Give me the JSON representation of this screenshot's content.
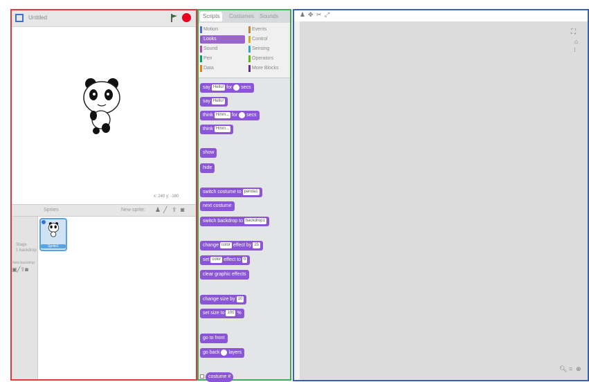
{
  "stage": {
    "title": "Untitled",
    "coords": "x: 240  y: -180",
    "sprites_header": "Sprites",
    "new_sprite_label": "New sprite:",
    "stage_label": "Stage",
    "stage_sub": "1 backdrop",
    "new_backdrop_label": "New backdrop:",
    "sprite_name": "Sprite1"
  },
  "palette": {
    "tabs": [
      "Scripts",
      "Costumes",
      "Sounds"
    ],
    "categories": [
      {
        "label": "Motion",
        "color": "#4a6cd4"
      },
      {
        "label": "Looks",
        "color": "#8a55d7",
        "selected": true
      },
      {
        "label": "Sound",
        "color": "#bb42c3"
      },
      {
        "label": "Pen",
        "color": "#0e9a6c"
      },
      {
        "label": "Data",
        "color": "#ee7d16"
      },
      {
        "label": "Events",
        "color": "#c88330"
      },
      {
        "label": "Control",
        "color": "#e1a91a"
      },
      {
        "label": "Sensing",
        "color": "#2ca5e2"
      },
      {
        "label": "Operators",
        "color": "#5cb712"
      },
      {
        "label": "More Blocks",
        "color": "#632d99"
      }
    ],
    "blocks": [
      {
        "parts": [
          "say",
          "Hello!",
          "for",
          "2",
          "secs"
        ]
      },
      {
        "parts": [
          "say",
          "Hello!"
        ]
      },
      {
        "parts": [
          "think",
          "Hmm...",
          "for",
          "2",
          "secs"
        ]
      },
      {
        "parts": [
          "think",
          "Hmm..."
        ]
      },
      {
        "parts": [
          "show"
        ]
      },
      {
        "parts": [
          "hide"
        ]
      },
      {
        "parts": [
          "switch costume to",
          "panda1"
        ]
      },
      {
        "parts": [
          "next costume"
        ]
      },
      {
        "parts": [
          "switch backdrop to",
          "backdrop1"
        ]
      },
      {
        "parts": [
          "change",
          "color",
          "effect by",
          "25"
        ]
      },
      {
        "parts": [
          "set",
          "color",
          "effect to",
          "0"
        ]
      },
      {
        "parts": [
          "clear graphic effects"
        ]
      },
      {
        "parts": [
          "change size by",
          "10"
        ]
      },
      {
        "parts": [
          "set size to",
          "100",
          "%"
        ]
      },
      {
        "parts": [
          "go to front"
        ]
      },
      {
        "parts": [
          "go back",
          "1",
          "layers"
        ]
      },
      {
        "parts": [
          "costume #"
        ]
      }
    ]
  },
  "script": {
    "toolbar_icons": [
      "person-icon",
      "duplicate-icon",
      "delete-icon",
      "grow-icon"
    ],
    "zoom_controls": [
      "zoom-out-icon",
      "zoom-reset-icon",
      "zoom-in-icon"
    ]
  },
  "colors": {
    "stage_border": "#e8363f",
    "palette_border": "#3dab5a",
    "script_border": "#3a5fb8",
    "looks_block": "#8a55d7"
  }
}
